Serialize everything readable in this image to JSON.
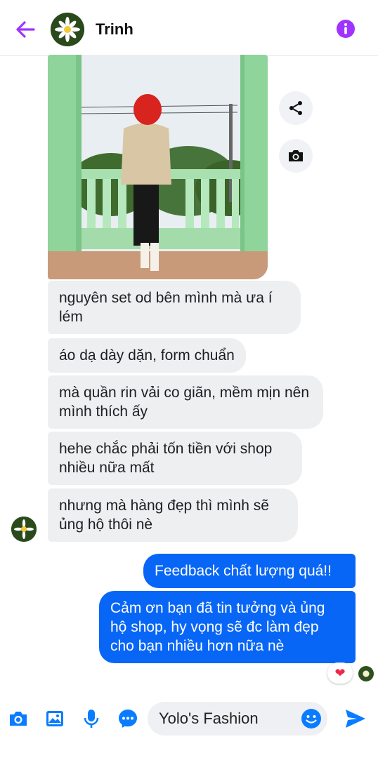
{
  "header": {
    "contact_name": "Trinh",
    "back_icon": "arrow-left-icon",
    "info_icon": "info-icon",
    "accent_color": "#a033ff"
  },
  "photo": {
    "side_actions": [
      "share-icon",
      "camera-icon"
    ]
  },
  "messages": [
    {
      "from": "contact",
      "text": "nguyên set od bên mình mà ưa í lém"
    },
    {
      "from": "contact",
      "text": "áo dạ dày dặn, form chuẩn"
    },
    {
      "from": "contact",
      "text": "mà quần rin vải co giãn, mềm mịn nên mình thích ấy"
    },
    {
      "from": "contact",
      "text": "hehe chắc phải tốn tiền với shop nhiều nữa mất"
    },
    {
      "from": "contact",
      "text": "nhưng mà hàng đẹp thì mình sẽ ủng hộ thôi nè"
    },
    {
      "from": "me",
      "text": "Feedback chất lượng quá!!"
    },
    {
      "from": "me",
      "text": "Cảm ơn bạn đã tin tưởng và ủng hộ shop, hy vọng sẽ đc làm đẹp cho bạn  nhiều hơn nữa nè",
      "reaction": "heart"
    }
  ],
  "composer": {
    "input_value": "Yolo's Fashion",
    "icons": [
      "camera-icon",
      "image-icon",
      "microphone-icon",
      "messenger-icon",
      "emoji-icon",
      "send-icon"
    ]
  },
  "colors": {
    "sent_bubble": "#0866f6",
    "received_bubble": "#eeeff1",
    "icon_blue": "#0a7cff"
  }
}
